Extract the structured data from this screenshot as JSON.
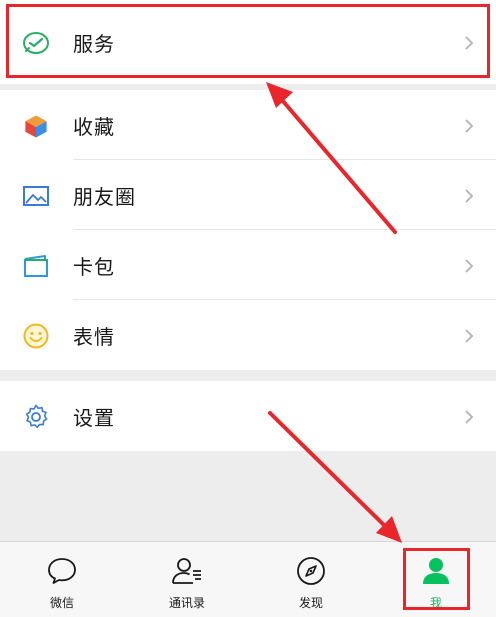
{
  "menu": {
    "services": {
      "label": "服务"
    },
    "collection": {
      "label": "收藏"
    },
    "moments": {
      "label": "朋友圈"
    },
    "cards": {
      "label": "卡包"
    },
    "stickers": {
      "label": "表情"
    },
    "settings": {
      "label": "设置"
    }
  },
  "tabbar": {
    "chats": "微信",
    "contacts": "通讯录",
    "discover": "发现",
    "me": "我"
  },
  "colors": {
    "wechat_green": "#07c160",
    "annotation_red": "#e8262c"
  },
  "icons": [
    "wallet-check-icon",
    "cube-icon",
    "picture-icon",
    "card-icon",
    "smile-icon",
    "gear-icon",
    "chat-bubble-icon",
    "contacts-icon",
    "compass-icon",
    "person-icon",
    "chevron-right-icon"
  ]
}
